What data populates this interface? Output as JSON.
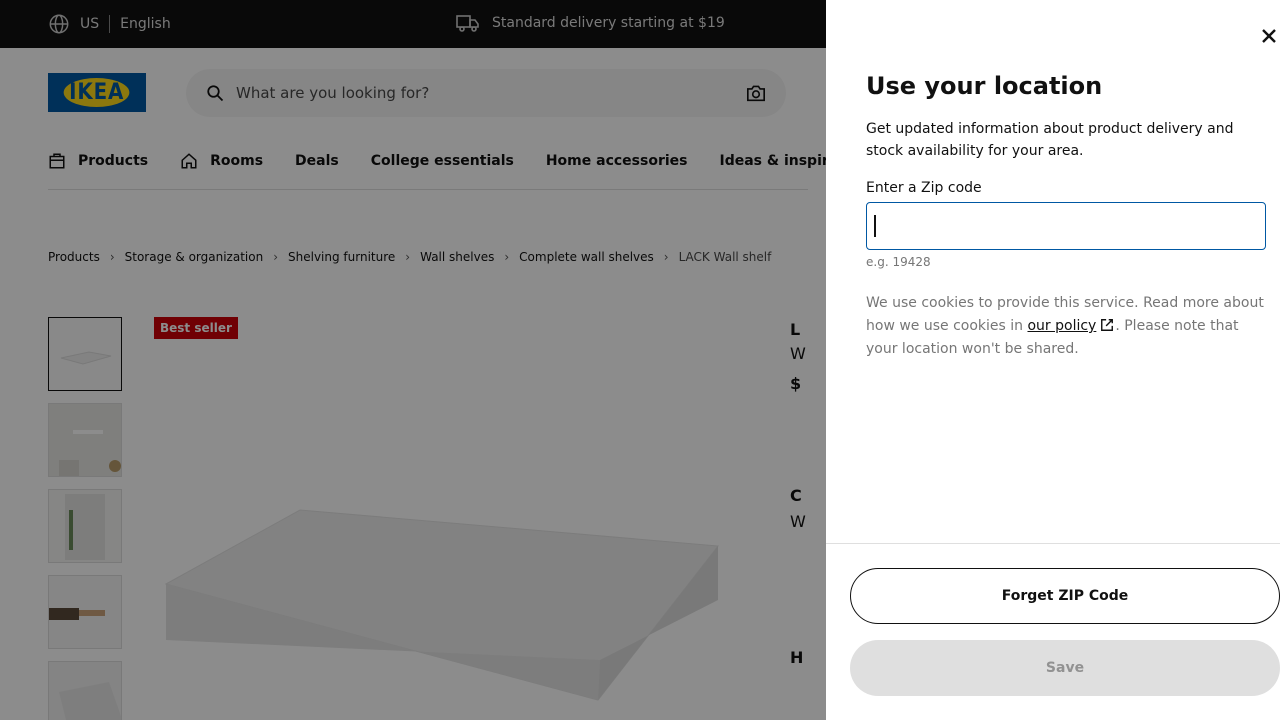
{
  "topbar": {
    "country": "US",
    "language": "English",
    "delivery": "Standard delivery starting at $19"
  },
  "header": {
    "logo": "IKEA",
    "search_placeholder": "What are you looking for?"
  },
  "nav": {
    "items": [
      "Products",
      "Rooms",
      "Deals",
      "College essentials",
      "Home accessories",
      "Ideas & inspira"
    ]
  },
  "breadcrumb": [
    "Products",
    "Storage & organization",
    "Shelving furniture",
    "Wall shelves",
    "Complete wall shelves",
    "LACK Wall shelf"
  ],
  "product": {
    "badge": "Best seller",
    "right_fragments": [
      "L",
      "W",
      "$",
      "C",
      "W",
      "H"
    ]
  },
  "modal": {
    "title": "Use your location",
    "description": "Get updated information about product delivery and stock availability for your area.",
    "zip_label": "Enter a Zip code",
    "zip_value": "",
    "zip_hint": "e.g. 19428",
    "cookie_text_1": "We use cookies to provide this service. Read more about how we use cookies in ",
    "cookie_link": "our policy",
    "cookie_text_2": ". Please note that your location won't be shared.",
    "forget_button": "Forget ZIP Code",
    "save_button": "Save"
  }
}
